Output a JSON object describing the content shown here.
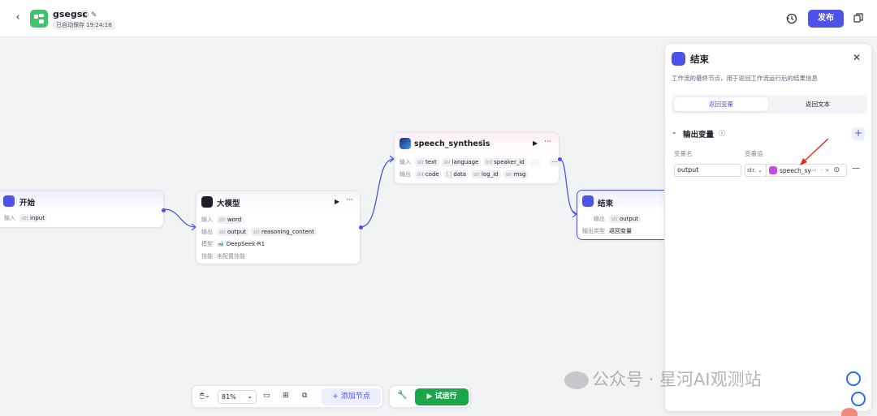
{
  "header": {
    "app_title": "gsegsc",
    "save_status": "已自动保存 19:24:18",
    "publish_label": "发布"
  },
  "nodes": {
    "start": {
      "title": "开始",
      "input_label": "输入",
      "input_var": "input"
    },
    "llm": {
      "title": "大模型",
      "input_label": "输入",
      "input_var": "word",
      "output_label": "输出",
      "output_vars": [
        "output",
        "reasoning_content"
      ],
      "model_label": "模型",
      "model_name": "DeepSeek-R1",
      "skill_label": "技能",
      "skill_value": "未配置技能"
    },
    "speech": {
      "title": "speech_synthesis",
      "input_label": "输入",
      "input_vars": [
        "text",
        "language",
        "speaker_id"
      ],
      "output_label": "输出",
      "output_vars": [
        "code",
        "data",
        "log_id",
        "msg"
      ]
    },
    "end": {
      "title": "结束",
      "output_label": "输出",
      "output_var": "output",
      "output_type_label": "输出类型",
      "output_type_value": "返回变量"
    }
  },
  "type_tags": {
    "str": "str",
    "int": "int",
    "list": "[ ]"
  },
  "panel": {
    "title": "结束",
    "description": "工作流的最终节点，用于返回工作流运行后的结果信息",
    "segments": [
      "返回变量",
      "返回文本"
    ],
    "section_title": "输出变量",
    "col_name": "变量名",
    "col_value": "变量值",
    "var_name": "output",
    "var_type": "str.",
    "ref_value": "speech_sy···",
    "ref_suffix": "- ×"
  },
  "toolbar": {
    "zoom": "81%",
    "add_node_label": "添加节点",
    "run_label": "试运行"
  },
  "watermark": {
    "text": "公众号 · 星河AI观测站"
  },
  "colors": {
    "accent": "#4d53e8",
    "run_green": "#1ca64b",
    "logo_green": "#3ec46d"
  }
}
